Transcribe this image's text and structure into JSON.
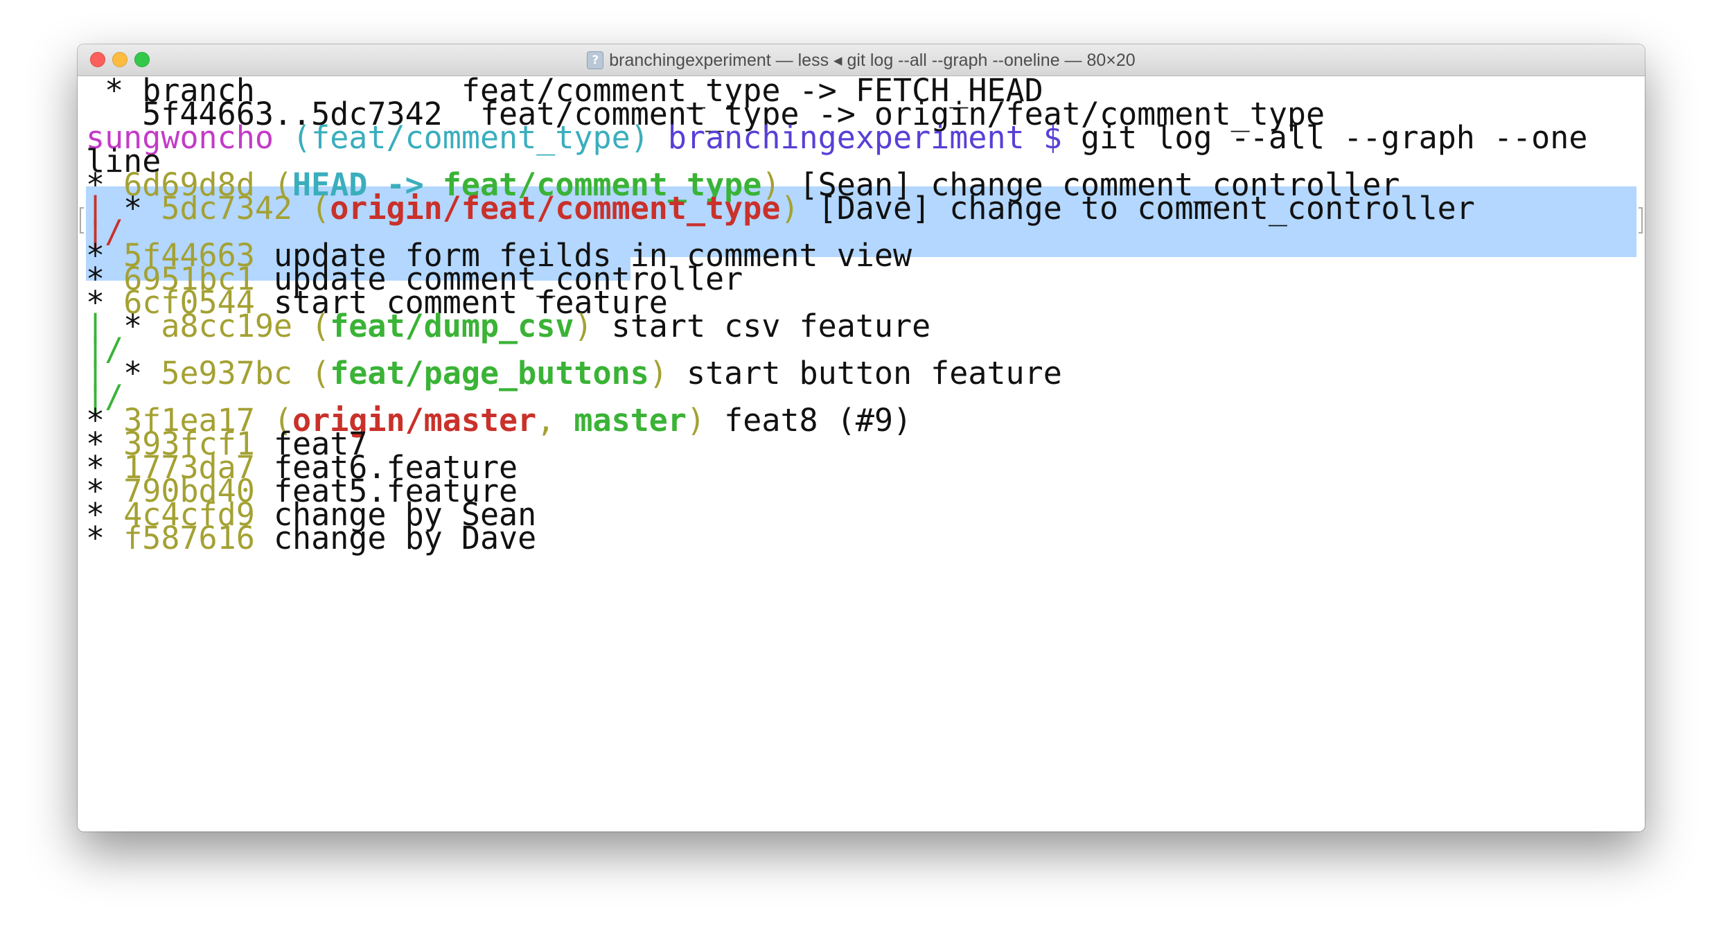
{
  "window": {
    "title": "branchingexperiment — less ◂ git log --all --graph --oneline — 80×20",
    "title_icon": "?"
  },
  "terminal": {
    "fetch_line_1": {
      "marker": "* branch",
      "ref": "feat/comment_type -> FETCH_HEAD"
    },
    "fetch_line_2": {
      "range": "5f44663..5dc7342",
      "ref": "feat/comment_type -> origin/feat/comment_type"
    },
    "prompt": {
      "user": "sungwoncho",
      "branch": "(feat/comment_type)",
      "dir": "branchingexperiment",
      "symbol": "$",
      "command": "git log --all --graph --one",
      "command_wrap": "line"
    },
    "log": [
      {
        "graph": "* ",
        "hash": "6d69d8d",
        "ref_open": "(",
        "ref_head": "HEAD",
        "ref_arrow": "->",
        "ref_branch": "feat/comment_type",
        "ref_close": ")",
        "message": "[Sean] change comment_controller"
      },
      {
        "graph_bar": "|",
        "graph_star": " * ",
        "hash": "5dc7342",
        "ref_open": "(",
        "ref_remote": "origin/feat/comment_type",
        "ref_close": ")",
        "message": "[Dave] change to comment_controller"
      },
      {
        "graph": "|/"
      },
      {
        "graph": "* ",
        "hash": "5f44663",
        "message": "update form feilds in comment view"
      },
      {
        "graph": "* ",
        "hash": "6951bc1",
        "message": "update comment_controller"
      },
      {
        "graph": "* ",
        "hash": "6cf0544",
        "message": "start comment feature"
      },
      {
        "graph_bar": "|",
        "graph_star": " * ",
        "hash": "a8cc19e",
        "ref_open": "(",
        "ref_branch": "feat/dump_csv",
        "ref_close": ")",
        "message": "start csv feature"
      },
      {
        "graph": "|/"
      },
      {
        "graph_bar": "|",
        "graph_star": " * ",
        "hash": "5e937bc",
        "ref_open": "(",
        "ref_branch": "feat/page_buttons",
        "ref_close": ")",
        "message": "start button feature"
      },
      {
        "graph": "|/"
      },
      {
        "graph": "* ",
        "hash": "3f1ea17",
        "ref_open": "(",
        "ref_remote": "origin/master",
        "ref_sep": ",",
        "ref_branch": "master",
        "ref_close": ")",
        "message": "feat8 (#9)"
      },
      {
        "graph": "* ",
        "hash": "393fcf1",
        "message": "feat7"
      },
      {
        "graph": "* ",
        "hash": "1773da7",
        "message": "feat6.feature"
      },
      {
        "graph": "* ",
        "hash": "790bd40",
        "message": "feat5.feature"
      },
      {
        "graph": "* ",
        "hash": "4c4cfd9",
        "message": "change by Sean"
      },
      {
        "graph": "* ",
        "hash": "f587616",
        "message": "change by Dave"
      }
    ]
  },
  "colors": {
    "selection": "#b3d7ff",
    "hash": "#a4a133",
    "branch": "#3ab336",
    "remote": "#c9312a",
    "head": "#3aaebd",
    "prompt_user": "#c33bc7",
    "prompt_dir": "#5a3fd6"
  }
}
